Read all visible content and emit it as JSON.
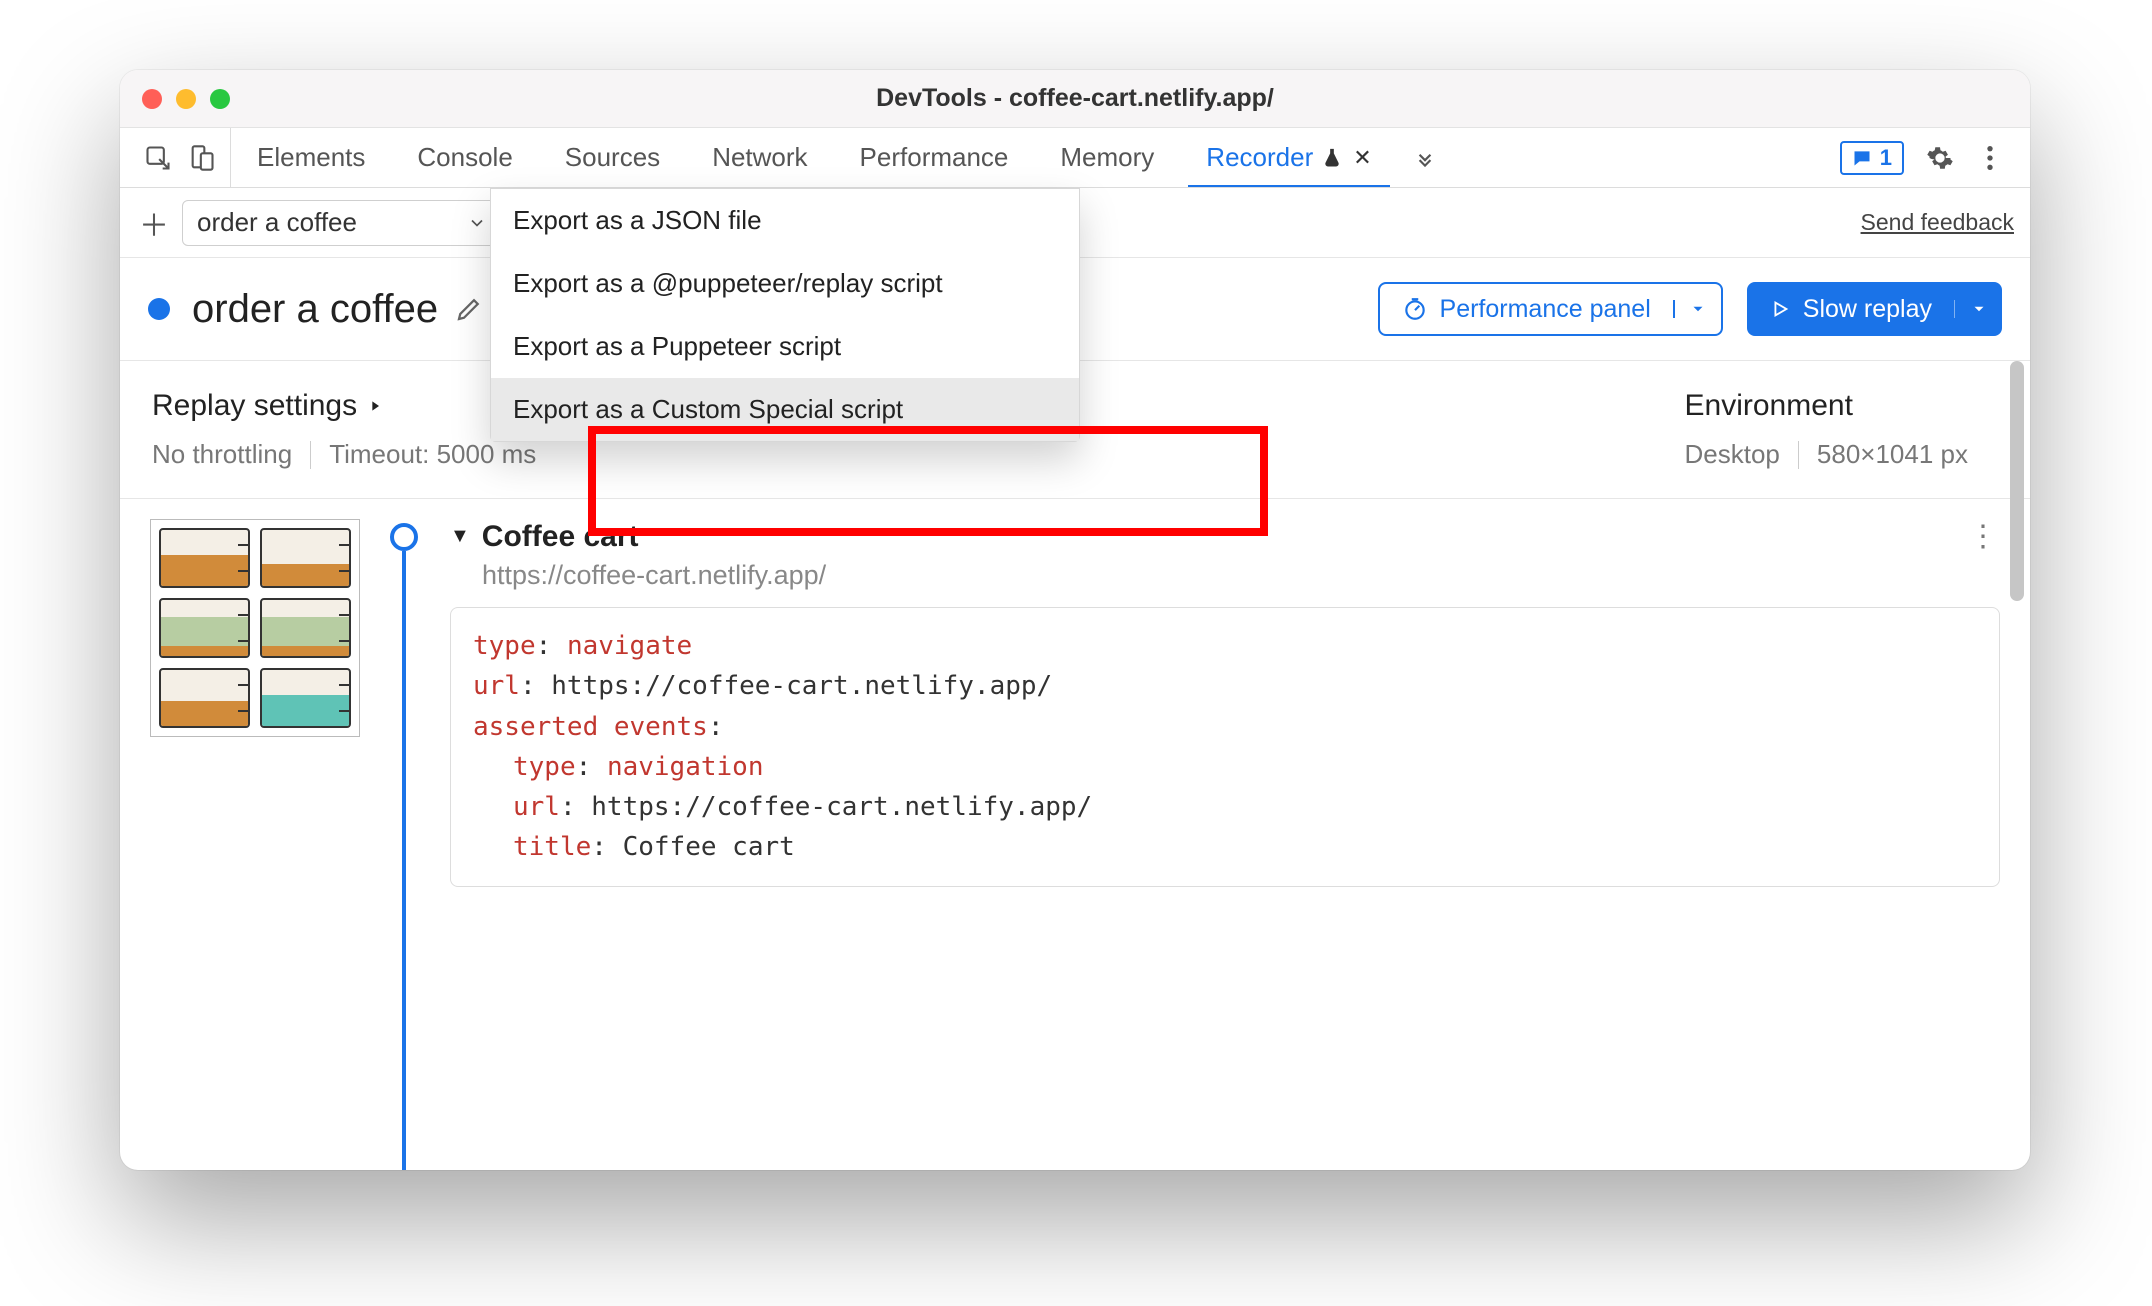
{
  "window": {
    "title": "DevTools - coffee-cart.netlify.app/"
  },
  "tabs": {
    "items": [
      "Elements",
      "Console",
      "Sources",
      "Network",
      "Performance",
      "Memory",
      "Recorder"
    ],
    "active": "Recorder",
    "messages_badge": "1"
  },
  "action_row": {
    "recording_name": "order a coffee",
    "feedback": "Send feedback"
  },
  "export_menu": {
    "items": [
      "Export as a JSON file",
      "Export as a @puppeteer/replay script",
      "Export as a Puppeteer script",
      "Export as a Custom Special script"
    ],
    "hover_index": 3
  },
  "rec_header": {
    "title": "order a coffee",
    "perf_btn": "Performance panel",
    "replay_btn": "Slow replay"
  },
  "meta": {
    "left_title": "Replay settings",
    "throttling": "No throttling",
    "timeout": "Timeout: 5000 ms",
    "env_title": "Environment",
    "device": "Desktop",
    "viewport": "580×1041 px"
  },
  "step": {
    "title": "Coffee cart",
    "url": "https://coffee-cart.netlify.app/",
    "code": {
      "l1k": "type",
      "l1v": "navigate",
      "l2k": "url",
      "l2v": "https://coffee-cart.netlify.app/",
      "l3k": "asserted events",
      "l4k": "type",
      "l4v": "navigation",
      "l5k": "url",
      "l5v": "https://coffee-cart.netlify.app/",
      "l6k": "title",
      "l6v": "Coffee cart"
    }
  }
}
